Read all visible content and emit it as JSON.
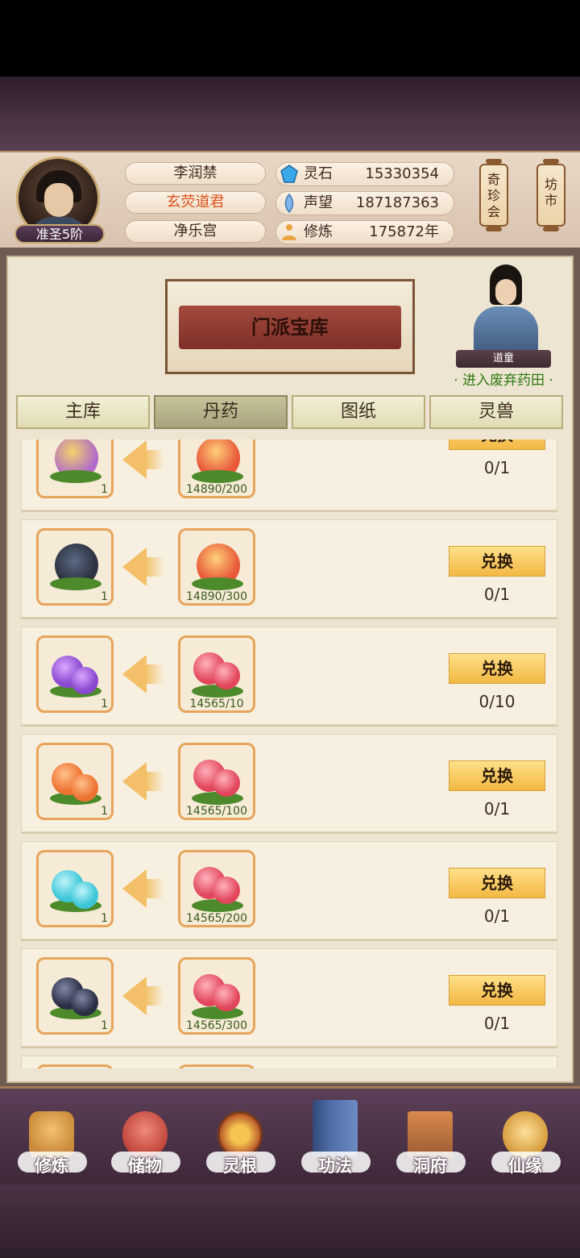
{
  "player": {
    "rank": "准圣5阶",
    "name": "李润禁",
    "title": "玄荧道君",
    "sect": "净乐宫"
  },
  "resources": [
    {
      "icon": "spirit-stone-icon",
      "label": "灵石",
      "value": "15330354"
    },
    {
      "icon": "reputation-icon",
      "label": "声望",
      "value": "187187363"
    },
    {
      "icon": "cultivation-icon",
      "label": "修炼",
      "value": "175872年"
    }
  ],
  "shortcuts": {
    "treasure_fair": "奇\n珍\n会",
    "market": "坊\n市"
  },
  "banner": {
    "title": "门派宝库"
  },
  "npc": {
    "name": "道童",
    "link": "· 进入废弃药田 ·"
  },
  "tabs": [
    {
      "label": "主库",
      "active": false
    },
    {
      "label": "丹药",
      "active": true
    },
    {
      "label": "图纸",
      "active": false
    },
    {
      "label": "灵兽",
      "active": false
    }
  ],
  "exchange_label": "兑换",
  "rows": [
    {
      "reward_item": "purple-peach-icon",
      "reward_count": "1",
      "cost_item": "red-peach-icon",
      "cost": "14890/200",
      "limit": "0/1"
    },
    {
      "reward_item": "black-peach-icon",
      "reward_count": "1",
      "cost_item": "red-peach-icon",
      "cost": "14890/300",
      "limit": "0/1"
    },
    {
      "reward_item": "purple-berry-icon",
      "reward_count": "1",
      "cost_item": "red-berry-icon",
      "cost": "14565/10",
      "limit": "0/10"
    },
    {
      "reward_item": "orange-berry-icon",
      "reward_count": "1",
      "cost_item": "red-berry-icon",
      "cost": "14565/100",
      "limit": "0/1"
    },
    {
      "reward_item": "cyan-berry-icon",
      "reward_count": "1",
      "cost_item": "red-berry-icon",
      "cost": "14565/200",
      "limit": "0/1"
    },
    {
      "reward_item": "dark-berry-icon",
      "reward_count": "1",
      "cost_item": "red-berry-icon",
      "cost": "14565/300",
      "limit": "0/1"
    }
  ],
  "nav": [
    {
      "label": "修炼",
      "icon": "cultivate-icon",
      "color": "#c98a3a"
    },
    {
      "label": "储物",
      "icon": "storage-bag-icon",
      "color": "#c0443a"
    },
    {
      "label": "灵根",
      "icon": "spirit-root-icon",
      "color": "#b8582a"
    },
    {
      "label": "功法",
      "icon": "technique-book-icon",
      "color": "#4f6ea8"
    },
    {
      "label": "洞府",
      "icon": "cave-dwelling-icon",
      "color": "#9c5a36"
    },
    {
      "label": "仙缘",
      "icon": "immortal-fate-icon",
      "color": "#d49a3a"
    }
  ],
  "colors": {
    "reward_peach_purple": "#b06ac9",
    "reward_peach_black": "#2e3340",
    "berry_purple": "#8a48d0",
    "berry_orange": "#ee7232",
    "berry_cyan": "#3cc6d8",
    "berry_dark": "#2b2f44",
    "berry_red": "#e2465c",
    "peach_red": "#e85a3a"
  }
}
